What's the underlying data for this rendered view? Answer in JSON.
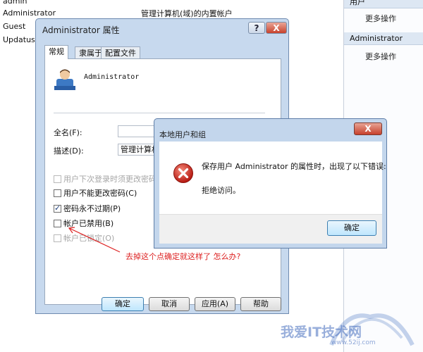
{
  "background": {
    "user_list": [
      "admin",
      "Administrator",
      "Guest",
      "UpdatusUs"
    ],
    "admin_description": "管理计算机(域)的内置帐户",
    "actions_pane": [
      {
        "header": "用户",
        "item": "更多操作"
      },
      {
        "header": "Administrator",
        "item": "更多操作"
      }
    ]
  },
  "properties_dialog": {
    "title": "Administrator 属性",
    "help_button": "?",
    "close_button": "X",
    "tabs": [
      "常规",
      "隶属于",
      "配置文件"
    ],
    "username": "Administrator",
    "full_name_label": "全名(F):",
    "full_name_value": "",
    "description_label": "描述(D):",
    "description_value": "管理计算机",
    "checkboxes": [
      {
        "label": "用户下次登录时须更改密码(M)",
        "checked": false,
        "disabled": true
      },
      {
        "label": "用户不能更改密码(C)",
        "checked": false,
        "disabled": false
      },
      {
        "label": "密码永不过期(P)",
        "checked": true,
        "disabled": false
      },
      {
        "label": "帐户已禁用(B)",
        "checked": false,
        "disabled": false
      },
      {
        "label": "帐户已锁定(O)",
        "checked": false,
        "disabled": true
      }
    ],
    "buttons": {
      "ok": "确定",
      "cancel": "取消",
      "apply": "应用(A)",
      "help": "帮助"
    },
    "annotation": "去掉这个点确定就这样了       怎么办?"
  },
  "error_dialog": {
    "title": "本地用户和组",
    "close_button": "X",
    "message": "保存用户 Administrator 的属性时，出现了以下错误:",
    "detail": "拒绝访问。",
    "ok_button": "确定"
  },
  "watermark": {
    "text": "我爱IT技术网",
    "url": "www.52ij.com"
  },
  "colors": {
    "accent": "#3c7fb1",
    "annotation": "#dd2222",
    "error": "#d4261b"
  }
}
